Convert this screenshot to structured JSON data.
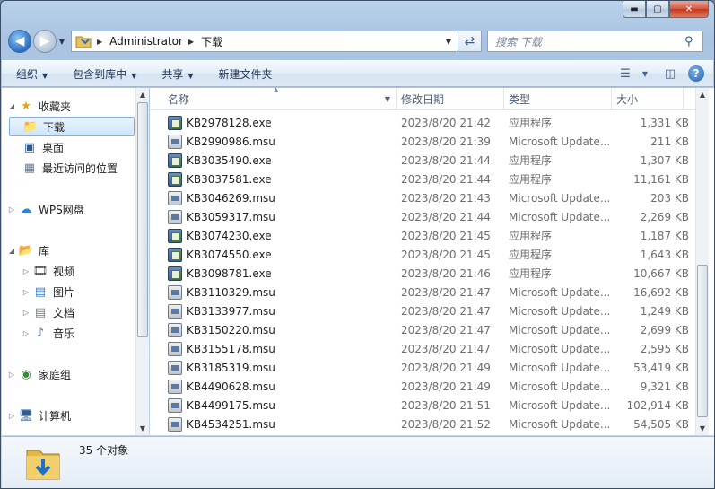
{
  "window": {
    "caption": {
      "minimize": "▬",
      "maximize": "▢",
      "close": "✕"
    }
  },
  "nav": {
    "path": [
      "Administrator",
      "下载"
    ],
    "search_placeholder": "搜索 下载"
  },
  "toolbar": {
    "organize": "组织",
    "include_in_library": "包含到库中",
    "share": "共享",
    "new_folder": "新建文件夹"
  },
  "navpane": {
    "favorites": "收藏夹",
    "downloads": "下载",
    "desktop": "桌面",
    "recent": "最近访问的位置",
    "wps": "WPS网盘",
    "libraries": "库",
    "videos": "视频",
    "pictures": "图片",
    "documents": "文档",
    "music": "音乐",
    "homegroup": "家庭组",
    "computer": "计算机"
  },
  "columns": {
    "name": "名称",
    "date": "修改日期",
    "type": "类型",
    "size": "大小"
  },
  "files": [
    {
      "name": "KB2978128.exe",
      "date": "2023/8/20 21:42",
      "type": "应用程序",
      "size": "1,331 KB",
      "kind": "exe"
    },
    {
      "name": "KB2990986.msu",
      "date": "2023/8/20 21:39",
      "type": "Microsoft Update...",
      "size": "211 KB",
      "kind": "msu"
    },
    {
      "name": "KB3035490.exe",
      "date": "2023/8/20 21:44",
      "type": "应用程序",
      "size": "1,307 KB",
      "kind": "exe"
    },
    {
      "name": "KB3037581.exe",
      "date": "2023/8/20 21:44",
      "type": "应用程序",
      "size": "11,161 KB",
      "kind": "exe"
    },
    {
      "name": "KB3046269.msu",
      "date": "2023/8/20 21:43",
      "type": "Microsoft Update...",
      "size": "203 KB",
      "kind": "msu"
    },
    {
      "name": "KB3059317.msu",
      "date": "2023/8/20 21:44",
      "type": "Microsoft Update...",
      "size": "2,269 KB",
      "kind": "msu"
    },
    {
      "name": "KB3074230.exe",
      "date": "2023/8/20 21:45",
      "type": "应用程序",
      "size": "1,187 KB",
      "kind": "exe"
    },
    {
      "name": "KB3074550.exe",
      "date": "2023/8/20 21:45",
      "type": "应用程序",
      "size": "1,643 KB",
      "kind": "exe"
    },
    {
      "name": "KB3098781.exe",
      "date": "2023/8/20 21:46",
      "type": "应用程序",
      "size": "10,667 KB",
      "kind": "exe"
    },
    {
      "name": "KB3110329.msu",
      "date": "2023/8/20 21:47",
      "type": "Microsoft Update...",
      "size": "16,692 KB",
      "kind": "msu"
    },
    {
      "name": "KB3133977.msu",
      "date": "2023/8/20 21:47",
      "type": "Microsoft Update...",
      "size": "1,249 KB",
      "kind": "msu"
    },
    {
      "name": "KB3150220.msu",
      "date": "2023/8/20 21:47",
      "type": "Microsoft Update...",
      "size": "2,699 KB",
      "kind": "msu"
    },
    {
      "name": "KB3155178.msu",
      "date": "2023/8/20 21:47",
      "type": "Microsoft Update...",
      "size": "2,595 KB",
      "kind": "msu"
    },
    {
      "name": "KB3185319.msu",
      "date": "2023/8/20 21:49",
      "type": "Microsoft Update...",
      "size": "53,419 KB",
      "kind": "msu"
    },
    {
      "name": "KB4490628.msu",
      "date": "2023/8/20 21:49",
      "type": "Microsoft Update...",
      "size": "9,321 KB",
      "kind": "msu"
    },
    {
      "name": "KB4499175.msu",
      "date": "2023/8/20 21:51",
      "type": "Microsoft Update...",
      "size": "102,914 KB",
      "kind": "msu"
    },
    {
      "name": "KB4534251.msu",
      "date": "2023/8/20 21:52",
      "type": "Microsoft Update...",
      "size": "54,505 KB",
      "kind": "msu"
    }
  ],
  "status": {
    "count": "35 个对象"
  }
}
